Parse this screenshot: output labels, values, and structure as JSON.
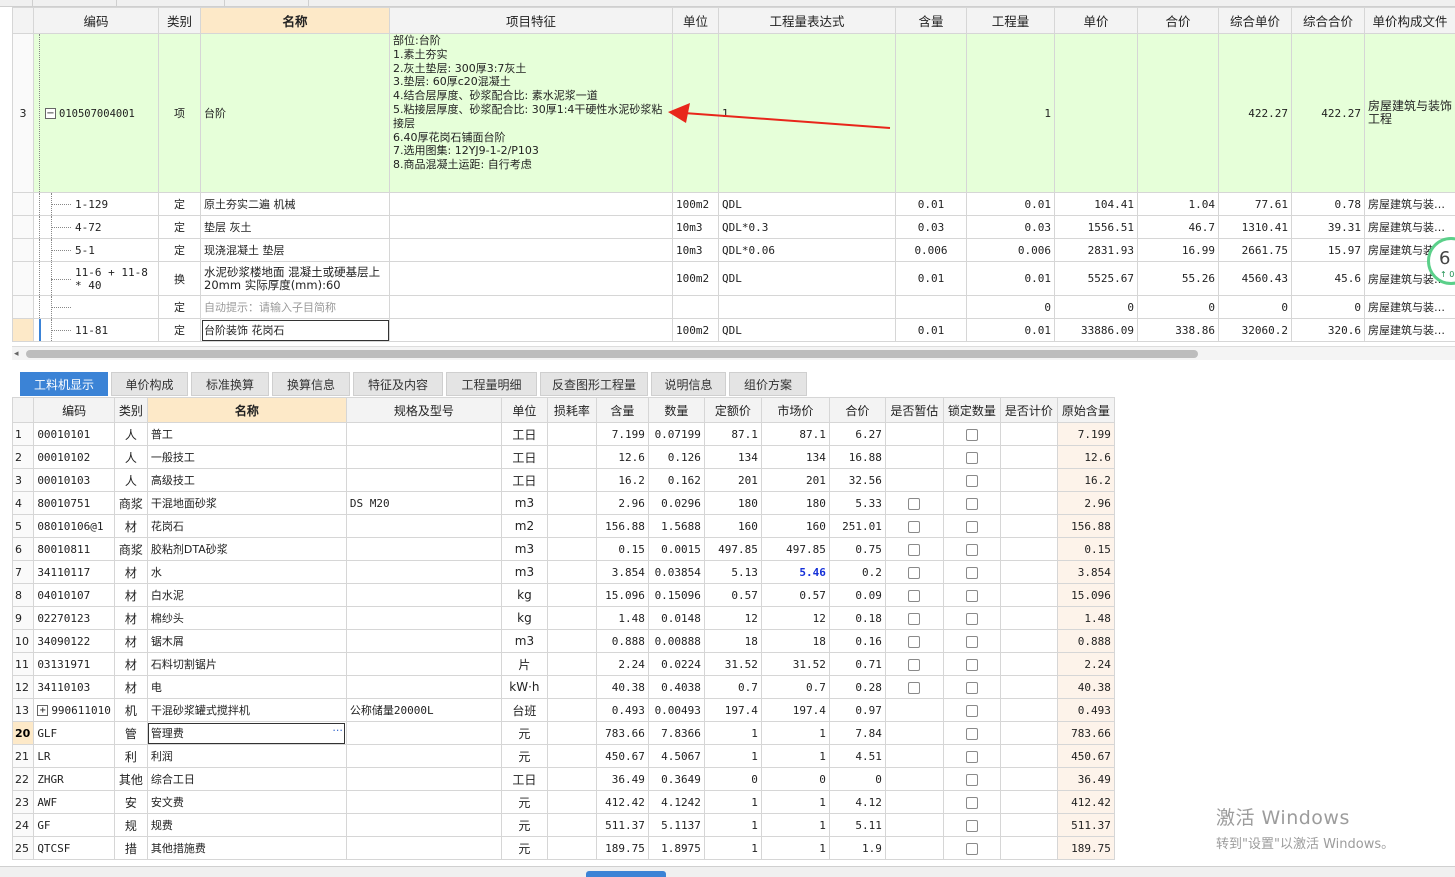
{
  "upper": {
    "headers": [
      "编码",
      "类别",
      "名称",
      "项目特征",
      "单位",
      "工程量表达式",
      "含量",
      "工程量",
      "单价",
      "合价",
      "综合单价",
      "综合合价",
      "单价构成文件"
    ],
    "main_row": {
      "num": "3",
      "expand": "−",
      "code": "010507004001",
      "type": "项",
      "name": "台阶",
      "features": [
        "部位:台阶",
        "1.素土夯实",
        "2.灰土垫层: 300厚3:7灰土",
        "3.垫层: 60厚c20混凝土",
        "4.结合层厚度、砂浆配合比: 素水泥浆一道",
        "5.粘接层厚度、砂浆配合比: 30厚1:4干硬性水泥砂浆粘接层",
        "6.40厚花岗石铺面台阶",
        "7.选用图集: 12YJ9-1-2/P103",
        "8.商品混凝土运距: 自行考虑"
      ],
      "unit": "",
      "expr": "1",
      "content": "",
      "qty": "1",
      "price": "",
      "total": "",
      "comp_price": "422.27",
      "comp_total": "422.27",
      "file": "房屋建筑与装饰工程"
    },
    "sub_rows": [
      {
        "code": "1-129",
        "type": "定",
        "name": "原土夯实二遍 机械",
        "unit": "100m2",
        "expr": "QDL",
        "content": "0.01",
        "qty": "0.01",
        "price": "104.41",
        "total": "1.04",
        "comp_price": "77.61",
        "comp_total": "0.78",
        "file": "房屋建筑与装…"
      },
      {
        "code": "4-72",
        "type": "定",
        "name": "垫层 灰土",
        "unit": "10m3",
        "expr": "QDL*0.3",
        "content": "0.03",
        "qty": "0.03",
        "price": "1556.51",
        "total": "46.7",
        "comp_price": "1310.41",
        "comp_total": "39.31",
        "file": "房屋建筑与装…"
      },
      {
        "code": "5-1",
        "type": "定",
        "name": "现浇混凝土 垫层",
        "unit": "10m3",
        "expr": "QDL*0.06",
        "content": "0.006",
        "qty": "0.006",
        "price": "2831.93",
        "total": "16.99",
        "comp_price": "2661.75",
        "comp_total": "15.97",
        "file": "房屋建筑与装…"
      },
      {
        "code": "11-6 + 11-8 * 40",
        "type": "换",
        "name": "水泥砂浆楼地面 混凝土或硬基层上 20mm  实际厚度(mm):60",
        "unit": "100m2",
        "expr": "QDL",
        "content": "0.01",
        "qty": "0.01",
        "price": "5525.67",
        "total": "55.26",
        "comp_price": "4560.43",
        "comp_total": "45.6",
        "file": "房屋建筑与装…"
      },
      {
        "code": "",
        "type": "定",
        "name": "自动提示：请输入子目简称",
        "unit": "",
        "expr": "",
        "content": "",
        "qty": "0",
        "price": "0",
        "total": "0",
        "comp_price": "0",
        "comp_total": "0",
        "file": "房屋建筑与装…"
      },
      {
        "code": "11-81",
        "type": "定",
        "name": "台阶装饰 花岗石",
        "unit": "100m2",
        "expr": "QDL",
        "content": "0.01",
        "qty": "0.01",
        "price": "33886.09",
        "total": "338.86",
        "comp_price": "32060.2",
        "comp_total": "320.6",
        "file": "房屋建筑与装…"
      }
    ]
  },
  "tabs": [
    "工料机显示",
    "单价构成",
    "标准换算",
    "换算信息",
    "特征及内容",
    "工程量明细",
    "反查图形工程量",
    "说明信息",
    "组价方案"
  ],
  "lower": {
    "headers": [
      "编码",
      "类别",
      "名称",
      "规格及型号",
      "单位",
      "损耗率",
      "含量",
      "数量",
      "定额价",
      "市场价",
      "合价",
      "是否暂估",
      "锁定数量",
      "是否计价",
      "原始含量"
    ],
    "rows": [
      {
        "num": "1",
        "code": "00010101",
        "type": "人",
        "name": "普工",
        "spec": "",
        "unit": "工日",
        "loss": "",
        "content": "7.199",
        "qty": "0.07199",
        "quota": "87.1",
        "market": "87.1",
        "total": "6.27",
        "est": false,
        "lock": true,
        "calc": "",
        "orig": "7.199"
      },
      {
        "num": "2",
        "code": "00010102",
        "type": "人",
        "name": "一般技工",
        "spec": "",
        "unit": "工日",
        "loss": "",
        "content": "12.6",
        "qty": "0.126",
        "quota": "134",
        "market": "134",
        "total": "16.88",
        "est": false,
        "lock": true,
        "calc": "",
        "orig": "12.6"
      },
      {
        "num": "3",
        "code": "00010103",
        "type": "人",
        "name": "高级技工",
        "spec": "",
        "unit": "工日",
        "loss": "",
        "content": "16.2",
        "qty": "0.162",
        "quota": "201",
        "market": "201",
        "total": "32.56",
        "est": false,
        "lock": true,
        "calc": "",
        "orig": "16.2"
      },
      {
        "num": "4",
        "code": "80010751",
        "type": "商浆",
        "name": "干混地面砂浆",
        "spec": "DS M20",
        "unit": "m3",
        "loss": "",
        "content": "2.96",
        "qty": "0.0296",
        "quota": "180",
        "market": "180",
        "total": "5.33",
        "est": true,
        "lock": true,
        "calc": "",
        "orig": "2.96"
      },
      {
        "num": "5",
        "code": "08010106@1",
        "type": "材",
        "name": "花岗石",
        "spec": "",
        "unit": "m2",
        "loss": "",
        "content": "156.88",
        "qty": "1.5688",
        "quota": "160",
        "market": "160",
        "total": "251.01",
        "est": true,
        "lock": true,
        "calc": "",
        "orig": "156.88"
      },
      {
        "num": "6",
        "code": "80010811",
        "type": "商浆",
        "name": "胶粘剂DTA砂浆",
        "spec": "",
        "unit": "m3",
        "loss": "",
        "content": "0.15",
        "qty": "0.0015",
        "quota": "497.85",
        "market": "497.85",
        "total": "0.75",
        "est": true,
        "lock": true,
        "calc": "",
        "orig": "0.15"
      },
      {
        "num": "7",
        "code": "34110117",
        "type": "材",
        "name": "水",
        "spec": "",
        "unit": "m3",
        "loss": "",
        "content": "3.854",
        "qty": "0.03854",
        "quota": "5.13",
        "market": "5.46",
        "total": "0.2",
        "est": true,
        "lock": true,
        "calc": "",
        "orig": "3.854",
        "blue": true
      },
      {
        "num": "8",
        "code": "04010107",
        "type": "材",
        "name": "白水泥",
        "spec": "",
        "unit": "kg",
        "loss": "",
        "content": "15.096",
        "qty": "0.15096",
        "quota": "0.57",
        "market": "0.57",
        "total": "0.09",
        "est": true,
        "lock": true,
        "calc": "",
        "orig": "15.096"
      },
      {
        "num": "9",
        "code": "02270123",
        "type": "材",
        "name": "棉纱头",
        "spec": "",
        "unit": "kg",
        "loss": "",
        "content": "1.48",
        "qty": "0.0148",
        "quota": "12",
        "market": "12",
        "total": "0.18",
        "est": true,
        "lock": true,
        "calc": "",
        "orig": "1.48"
      },
      {
        "num": "10",
        "code": "34090122",
        "type": "材",
        "name": "锯木屑",
        "spec": "",
        "unit": "m3",
        "loss": "",
        "content": "0.888",
        "qty": "0.00888",
        "quota": "18",
        "market": "18",
        "total": "0.16",
        "est": true,
        "lock": true,
        "calc": "",
        "orig": "0.888"
      },
      {
        "num": "11",
        "code": "03131971",
        "type": "材",
        "name": "石料切割锯片",
        "spec": "",
        "unit": "片",
        "loss": "",
        "content": "2.24",
        "qty": "0.0224",
        "quota": "31.52",
        "market": "31.52",
        "total": "0.71",
        "est": true,
        "lock": true,
        "calc": "",
        "orig": "2.24"
      },
      {
        "num": "12",
        "code": "34110103",
        "type": "材",
        "name": "电",
        "spec": "",
        "unit": "kW·h",
        "loss": "",
        "content": "40.38",
        "qty": "0.4038",
        "quota": "0.7",
        "market": "0.7",
        "total": "0.28",
        "est": true,
        "lock": true,
        "calc": "",
        "orig": "40.38"
      },
      {
        "num": "13",
        "code": "990611010",
        "type": "机",
        "name": "干混砂浆罐式搅拌机",
        "spec": "公称储量20000L",
        "unit": "台班",
        "loss": "",
        "content": "0.493",
        "qty": "0.00493",
        "quota": "197.4",
        "market": "197.4",
        "total": "0.97",
        "est": false,
        "lock": true,
        "calc": "",
        "orig": "0.493",
        "expand": "+"
      },
      {
        "num": "20",
        "code": "GLF",
        "type": "管",
        "name": "管理费",
        "spec": "",
        "unit": "元",
        "loss": "",
        "content": "783.66",
        "qty": "7.8366",
        "quota": "1",
        "market": "1",
        "total": "7.84",
        "est": false,
        "lock": true,
        "calc": "",
        "orig": "783.66",
        "current": true
      },
      {
        "num": "21",
        "code": "LR",
        "type": "利",
        "name": "利润",
        "spec": "",
        "unit": "元",
        "loss": "",
        "content": "450.67",
        "qty": "4.5067",
        "quota": "1",
        "market": "1",
        "total": "4.51",
        "est": false,
        "lock": true,
        "calc": "",
        "orig": "450.67"
      },
      {
        "num": "22",
        "code": "ZHGR",
        "type": "其他",
        "name": "综合工日",
        "spec": "",
        "unit": "工日",
        "loss": "",
        "content": "36.49",
        "qty": "0.3649",
        "quota": "0",
        "market": "0",
        "total": "0",
        "est": false,
        "lock": true,
        "calc": "",
        "orig": "36.49"
      },
      {
        "num": "23",
        "code": "AWF",
        "type": "安",
        "name": "安文费",
        "spec": "",
        "unit": "元",
        "loss": "",
        "content": "412.42",
        "qty": "4.1242",
        "quota": "1",
        "market": "1",
        "total": "4.12",
        "est": false,
        "lock": true,
        "calc": "",
        "orig": "412.42"
      },
      {
        "num": "24",
        "code": "GF",
        "type": "规",
        "name": "规费",
        "spec": "",
        "unit": "元",
        "loss": "",
        "content": "511.37",
        "qty": "5.1137",
        "quota": "1",
        "market": "1",
        "total": "5.11",
        "est": false,
        "lock": true,
        "calc": "",
        "orig": "511.37"
      },
      {
        "num": "25",
        "code": "QTCSF",
        "type": "措",
        "name": "其他措施费",
        "spec": "",
        "unit": "元",
        "loss": "",
        "content": "189.75",
        "qty": "1.8975",
        "quota": "1",
        "market": "1",
        "total": "1.9",
        "est": false,
        "lock": true,
        "calc": "",
        "orig": "189.75"
      }
    ]
  },
  "ellipsis": "···",
  "widget": {
    "value": "6",
    "sub": "↑ 0."
  },
  "watermark": {
    "line1": "激活 Windows",
    "line2": "转到\"设置\"以激活 Windows。"
  },
  "colors": {
    "accent_tab": "#3b83d6",
    "main_row_bg": "#e6ffd9",
    "header_highlight": "#fde9c8",
    "annotation_arrow": "#e8261b"
  }
}
